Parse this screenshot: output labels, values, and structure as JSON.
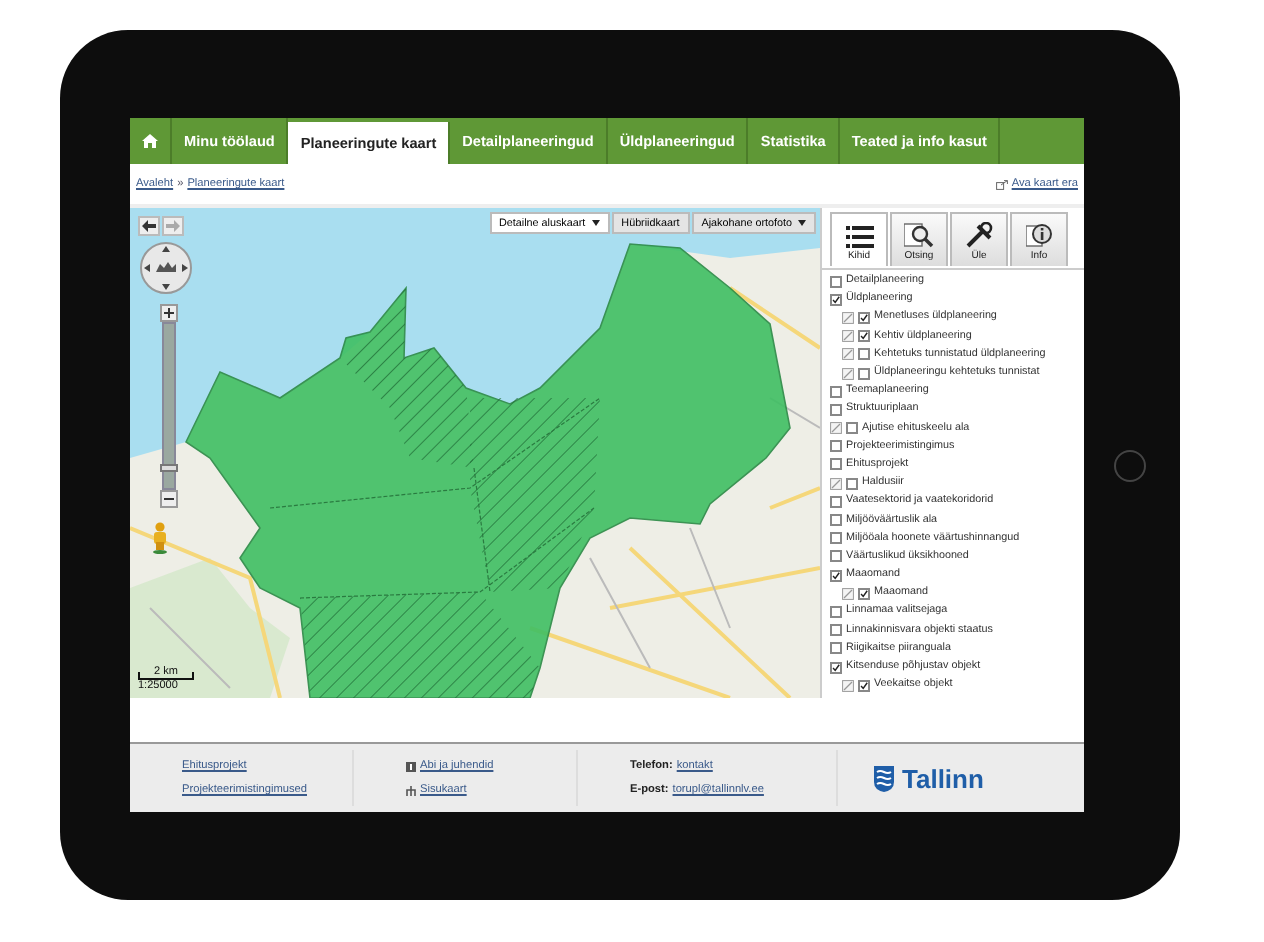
{
  "home_tab": {
    "selected": false
  },
  "tabs": [
    {
      "label": "Minu töölaud",
      "selected": false
    },
    {
      "label": "Planeeringute kaart",
      "selected": true
    },
    {
      "label": "Detailplaneeringud",
      "selected": false
    },
    {
      "label": "Üldplaneeringud",
      "selected": false
    },
    {
      "label": "Statistika",
      "selected": false
    },
    {
      "label": "Teated ja info kasut",
      "selected": false
    }
  ],
  "breadcrumb": {
    "items": [
      "Avaleht",
      "Planeeringute kaart"
    ],
    "separator": "»"
  },
  "open_link": "Ava kaart era",
  "map": {
    "basemaps": [
      {
        "label": "Detailne aluskaart",
        "dropdown": true,
        "selected": true
      },
      {
        "label": "Hübriidkaart",
        "dropdown": false,
        "selected": false
      },
      {
        "label": "Ajakohane ortofoto",
        "dropdown": true,
        "selected": false
      }
    ],
    "zoom": {
      "level": 0.1
    },
    "scale": {
      "distance": "2 km",
      "ratio": "1:25000"
    }
  },
  "panel_tabs": [
    {
      "label": "Kihid",
      "kind": "list",
      "selected": true
    },
    {
      "label": "Otsing",
      "kind": "search",
      "selected": false
    },
    {
      "label": "Üle",
      "kind": "tools",
      "selected": false
    },
    {
      "label": "Info",
      "kind": "info",
      "selected": false
    }
  ],
  "layers": [
    {
      "label": "Detailplaneering",
      "checked": false,
      "legend": false
    },
    {
      "label": "Üldplaneering",
      "checked": true,
      "legend": false,
      "children": [
        {
          "label": "Menetluses üldplaneering",
          "checked": true,
          "legend": true
        },
        {
          "label": "Kehtiv üldplaneering",
          "checked": true,
          "legend": true
        },
        {
          "label": "Kehtetuks tunnistatud üldplaneering",
          "checked": false,
          "legend": true
        },
        {
          "label": "Üldplaneeringu kehtetuks tunnistat",
          "checked": false,
          "legend": true
        }
      ]
    },
    {
      "label": "Teemaplaneering",
      "checked": false,
      "legend": false
    },
    {
      "label": "Struktuuriplaan",
      "checked": false,
      "legend": false
    },
    {
      "label": "Ajutise ehituskeelu ala",
      "checked": false,
      "legend": true
    },
    {
      "label": "Projekteerimistingimus",
      "checked": false,
      "legend": false
    },
    {
      "label": "Ehitusprojekt",
      "checked": false,
      "legend": false
    },
    {
      "label": "Haldusiir",
      "checked": false,
      "legend": true
    },
    {
      "label": "Vaatesektorid ja vaatekoridorid",
      "checked": false,
      "legend": false
    },
    {
      "label": "Miljööväärtuslik ala",
      "checked": false,
      "legend": false
    },
    {
      "label": "Miljööala hoonete väärtushinnangud",
      "checked": false,
      "legend": false
    },
    {
      "label": "Väärtuslikud üksikhooned",
      "checked": false,
      "legend": false
    },
    {
      "label": "Maaomand",
      "checked": true,
      "legend": false,
      "children": [
        {
          "label": "Maaomand",
          "checked": true,
          "legend": true
        }
      ]
    },
    {
      "label": "Linnamaa valitsejaga",
      "checked": false,
      "legend": false
    },
    {
      "label": "Linnakinnisvara objekti staatus",
      "checked": false,
      "legend": false
    },
    {
      "label": "Riigikaitse piiranguala",
      "checked": false,
      "legend": false
    },
    {
      "label": "Kitsenduse põhjustav objekt",
      "checked": true,
      "legend": false,
      "children": [
        {
          "label": "Veekaitse objekt",
          "checked": true,
          "legend": true
        }
      ]
    }
  ],
  "footer": {
    "links": [
      "Ehitusprojekt",
      "Projekteerimistingimused"
    ],
    "help_links": [
      {
        "label": "Abi ja juhendid",
        "kind": "help"
      },
      {
        "label": "Sisukaart",
        "kind": "sitemap"
      }
    ],
    "contacts": [
      {
        "label": "Telefon:",
        "link": "kontakt"
      },
      {
        "label": "E-post:",
        "link": "torupl@tallinnlv.ee"
      }
    ],
    "logo": "Tallinn"
  }
}
